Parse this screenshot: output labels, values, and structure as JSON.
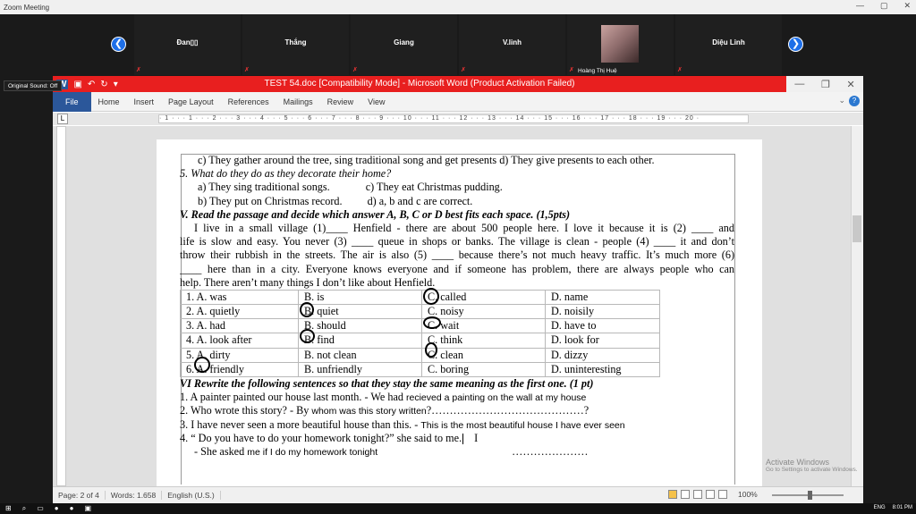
{
  "zoom": {
    "title": "Zoom Meeting",
    "participants": [
      {
        "name": "Đan▯▯"
      },
      {
        "name": "Thắng"
      },
      {
        "name": "Giang"
      },
      {
        "name": "V.linh"
      },
      {
        "name": "Hoàng Thị Huệ"
      },
      {
        "name": "Diệu Linh"
      }
    ],
    "original_sound": "Original Sound: Off"
  },
  "word": {
    "title": "TEST 54.doc [Compatibility Mode] - Microsoft Word (Product Activation Failed)",
    "tabs": [
      "File",
      "Home",
      "Insert",
      "Page Layout",
      "References",
      "Mailings",
      "Review",
      "View"
    ],
    "ruler_text": "· 1 · · · 1 · · · 2 · · · 3 · · · 4 · · · 5 · · · 6 · · · 7 · · · 8 · · · 9 · · · 10 · · · 11 · · · 12 · · · 13 · · · 14 · · · 15 · · · 16 · · · 17 · · · 18 · · · 19 · · · 20 ·",
    "status": {
      "page": "Page: 2 of 4",
      "words": "Words: 1.658",
      "lang": "English (U.S.)",
      "zoom": "100%"
    }
  },
  "doc": {
    "l1": "c) They gather around the tree, sing traditional song and get presents     d) They give presents to each other.",
    "q5": "5. What do they do as they decorate their home?",
    "q5a": "a) They sing traditional songs.",
    "q5c": "c) They eat Christmas pudding.",
    "q5b": "b) They put on Christmas record.",
    "q5d": "d) a, b and c are correct.",
    "sec5": "V. Read the passage and decide which answer A, B, C or D  best fits each space. (1,5pts)",
    "p1": "I live in a small village (1)____ Henfield - there are about 500 people here. I love it because it is (2) ____ and",
    "p2": "life is slow and easy. You never (3) ____ queue in shops or banks. The village is clean - people (4) ____ it and don’t",
    "p3": "throw their rubbish in the streets. The air is also (5) ____ because there’s not much heavy traffic. It’s much more (6)",
    "p4": "____ here than in a city. Everyone knows everyone and if someone has problem, there are always people who can",
    "p5": "help. There aren’t many things I don’t like about Henfield.",
    "table": [
      [
        "1. A. was",
        "B. is",
        "C. called",
        "D. name"
      ],
      [
        "2. A. quietly",
        "B. quiet",
        "C. noisy",
        "D. noisily"
      ],
      [
        "3. A. had",
        "B. should",
        "C. wait",
        "D. have to"
      ],
      [
        "4. A. look after",
        "B. find",
        "C. think",
        "D. look for"
      ],
      [
        "5. A. dirty",
        "B. not clean",
        "C. clean",
        "D. dizzy"
      ],
      [
        "6. A. friendly",
        "B. unfriendly",
        "C. boring",
        "D. uninteresting"
      ]
    ],
    "sec6": "VI  Rewrite the following sentences so that they stay the same meaning as the first one. (1 pt)",
    "r1a": "1. A painter painted our house last month.     - We had ",
    "r1b": "recieved a painting on the wall at my house",
    "r2a": "2. Who wrote this story?      - By ",
    "r2b": "whom was this story written",
    "r2c": "?……………………………………?",
    "r3a": "3. I have never seen a more beautiful house than this.      - ",
    "r3b": "This is the most beautiful house I have ever seen",
    "r4": "4. “ Do you have to do your homework tonight?” she said to me.",
    "r5a": "-  She asked ",
    "r5b": "me if I do my homework tonight",
    "r5c": "…………………"
  },
  "activation": {
    "title": "Activate Windows",
    "sub": "Go to Settings to activate Windows."
  },
  "taskbar": {
    "lang": "ENG",
    "time": "8:01 PM"
  }
}
